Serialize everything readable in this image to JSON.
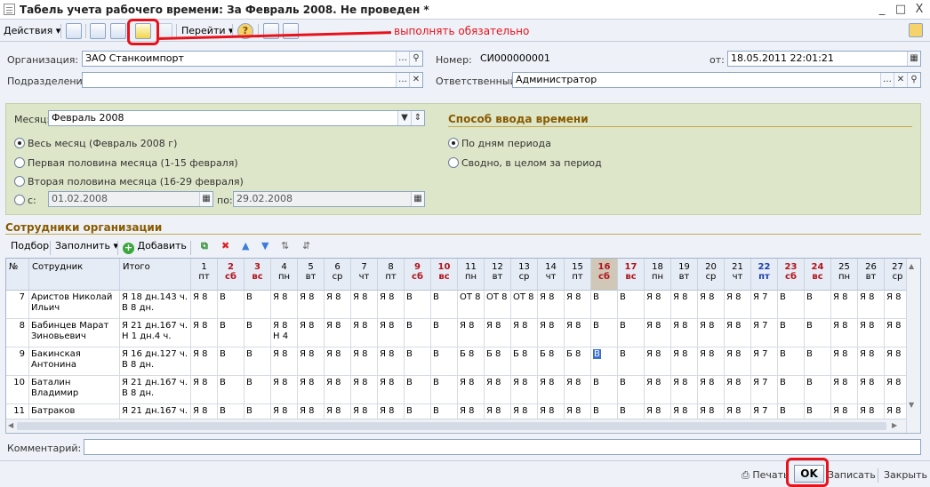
{
  "window": {
    "title": "Табель учета рабочего времени: За Февраль 2008. Не проведен *",
    "controls": [
      "_",
      "□",
      "X"
    ]
  },
  "toolbar": {
    "actions": "Действия",
    "goto": "Перейти",
    "hint": "выполнять обязательно",
    "help_icon": "?"
  },
  "header": {
    "org_label": "Организация:",
    "org_value": "ЗАО Станкоимпорт",
    "dept_label": "Подразделение:",
    "dept_value": "",
    "number_label": "Номер:",
    "number_value": "СИ000000001",
    "date_label": "от:",
    "date_value": "18.05.2011 22:01:21",
    "resp_label": "Ответственный:",
    "resp_value": "Администратор"
  },
  "period": {
    "month_label": "Месяц:",
    "month_value": "Февраль 2008",
    "opt_full": "Весь месяц (Февраль 2008 г)",
    "opt_first": "Первая половина месяца (1-15 февраля)",
    "opt_second": "Вторая половина месяца (16-29 февраля)",
    "opt_from": "с:",
    "from_value": "01.02.2008",
    "to_label": "по:",
    "to_value": "29.02.2008",
    "input_title": "Способ ввода времени",
    "input_by_days": "По дням периода",
    "input_total": "Сводно, в целом за период"
  },
  "employees": {
    "section_title": "Сотрудники организации",
    "select": "Подбор",
    "fill": "Заполнить",
    "add": "Добавить",
    "col_no": "№",
    "col_emp": "Сотрудник",
    "col_total": "Итого",
    "days": [
      {
        "n": "1",
        "d": "пт",
        "w": false
      },
      {
        "n": "2",
        "d": "сб",
        "w": true
      },
      {
        "n": "3",
        "d": "вс",
        "w": true
      },
      {
        "n": "4",
        "d": "пн",
        "w": false
      },
      {
        "n": "5",
        "d": "вт",
        "w": false
      },
      {
        "n": "6",
        "d": "ср",
        "w": false
      },
      {
        "n": "7",
        "d": "чт",
        "w": false
      },
      {
        "n": "8",
        "d": "пт",
        "w": false
      },
      {
        "n": "9",
        "d": "сб",
        "w": true
      },
      {
        "n": "10",
        "d": "вс",
        "w": true
      },
      {
        "n": "11",
        "d": "пн",
        "w": false
      },
      {
        "n": "12",
        "d": "вт",
        "w": false
      },
      {
        "n": "13",
        "d": "ср",
        "w": false
      },
      {
        "n": "14",
        "d": "чт",
        "w": false
      },
      {
        "n": "15",
        "d": "пт",
        "w": false
      },
      {
        "n": "16",
        "d": "сб",
        "w": true
      },
      {
        "n": "17",
        "d": "вс",
        "w": true
      },
      {
        "n": "18",
        "d": "пн",
        "w": false
      },
      {
        "n": "19",
        "d": "вт",
        "w": false
      },
      {
        "n": "20",
        "d": "ср",
        "w": false
      },
      {
        "n": "21",
        "d": "чт",
        "w": false
      },
      {
        "n": "22",
        "d": "пт",
        "w": false,
        "blue": true
      },
      {
        "n": "23",
        "d": "сб",
        "w": true
      },
      {
        "n": "24",
        "d": "вс",
        "w": true
      },
      {
        "n": "25",
        "d": "пн",
        "w": false
      },
      {
        "n": "26",
        "d": "вт",
        "w": false
      },
      {
        "n": "27",
        "d": "ср",
        "w": false
      }
    ],
    "rows": [
      {
        "no": "7",
        "name": "Аристов Николай Ильич",
        "total": "Я 18 дн.143 ч. В 8 дн.",
        "cells": [
          "Я 8",
          "В",
          "В",
          "Я 8",
          "Я 8",
          "Я 8",
          "Я 8",
          "Я 8",
          "В",
          "В",
          "ОТ 8",
          "ОТ 8",
          "ОТ 8",
          "Я 8",
          "Я 8",
          "В",
          "В",
          "Я 8",
          "Я 8",
          "Я 8",
          "Я 8",
          "Я 7",
          "В",
          "В",
          "Я 8",
          "Я 8",
          "Я 8"
        ]
      },
      {
        "no": "8",
        "name": "Бабинцев Марат Зиновьевич",
        "total": "Я 21 дн.167 ч. Н 1 дн.4 ч.",
        "cells": [
          "Я 8",
          "В",
          "В",
          "Я 8 Н 4",
          "Я 8",
          "Я 8",
          "Я 8",
          "Я 8",
          "В",
          "В",
          "Я 8",
          "Я 8",
          "Я 8",
          "Я 8",
          "Я 8",
          "В",
          "В",
          "Я 8",
          "Я 8",
          "Я 8",
          "Я 8",
          "Я 7",
          "В",
          "В",
          "Я 8",
          "Я 8",
          "Я 8"
        ]
      },
      {
        "no": "9",
        "name": "Бакинская Антонина",
        "total": "Я 16 дн.127 ч. В 8 дн.",
        "cells": [
          "Я 8",
          "В",
          "В",
          "Я 8",
          "Я 8",
          "Я 8",
          "Я 8",
          "Я 8",
          "В",
          "В",
          "Б 8",
          "Б 8",
          "Б 8",
          "Б 8",
          "Б 8",
          "В",
          "В",
          "Я 8",
          "Я 8",
          "Я 8",
          "Я 8",
          "Я 7",
          "В",
          "В",
          "Я 8",
          "Я 8",
          "Я 8"
        ]
      },
      {
        "no": "10",
        "name": "Баталин Владимир",
        "total": "Я 21 дн.167 ч. В 8 дн.",
        "cells": [
          "Я 8",
          "В",
          "В",
          "Я 8",
          "Я 8",
          "Я 8",
          "Я 8",
          "Я 8",
          "В",
          "В",
          "Я 8",
          "Я 8",
          "Я 8",
          "Я 8",
          "Я 8",
          "В",
          "В",
          "Я 8",
          "Я 8",
          "Я 8",
          "Я 8",
          "Я 7",
          "В",
          "В",
          "Я 8",
          "Я 8",
          "Я 8"
        ]
      },
      {
        "no": "11",
        "name": "Батраков",
        "total": "Я 21 дн.167 ч.",
        "cells": [
          "Я 8",
          "В",
          "В",
          "Я 8",
          "Я 8",
          "Я 8",
          "Я 8",
          "Я 8",
          "В",
          "В",
          "Я 8",
          "Я 8",
          "Я 8",
          "Я 8",
          "Я 8",
          "В",
          "В",
          "Я 8",
          "Я 8",
          "Я 8",
          "Я 8",
          "Я 7",
          "В",
          "В",
          "Я 8",
          "Я 8",
          "Я 8"
        ]
      }
    ]
  },
  "footer": {
    "comment_label": "Комментарий:",
    "comment_value": "",
    "print": "Печать",
    "ok": "OK",
    "save": "Записать",
    "close": "Закрыть"
  }
}
